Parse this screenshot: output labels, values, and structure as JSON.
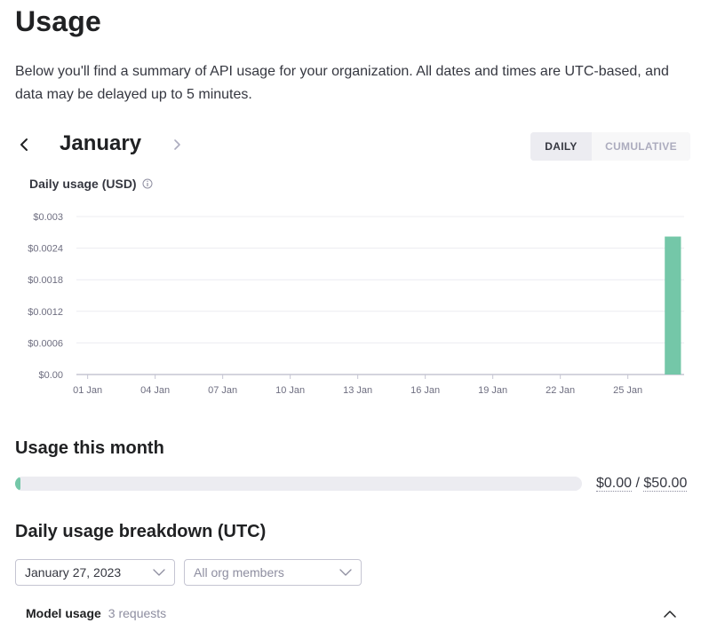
{
  "page": {
    "title": "Usage",
    "description": "Below you'll find a summary of API usage for your organization. All dates and times are UTC-based, and data may be delayed up to 5 minutes."
  },
  "month_nav": {
    "month": "January",
    "prev_icon": "chevron-left-icon",
    "next_icon": "chevron-right-icon"
  },
  "view_toggle": {
    "options": [
      "DAILY",
      "CUMULATIVE"
    ],
    "selected": "DAILY"
  },
  "chart_label": "Daily usage (USD)",
  "info_icon": "info-icon",
  "chart_data": {
    "type": "bar",
    "title": "Daily usage (USD)",
    "x_tick_labels": [
      "01 Jan",
      "04 Jan",
      "07 Jan",
      "10 Jan",
      "13 Jan",
      "16 Jan",
      "19 Jan",
      "22 Jan",
      "25 Jan"
    ],
    "y_tick_labels": [
      "$0.00",
      "$0.0006",
      "$0.0012",
      "$0.0018",
      "$0.0024",
      "$0.003"
    ],
    "ylim": [
      0,
      0.003
    ],
    "grid": true,
    "bar_color": "#74c7a8",
    "categories": [
      "01 Jan",
      "02 Jan",
      "03 Jan",
      "04 Jan",
      "05 Jan",
      "06 Jan",
      "07 Jan",
      "08 Jan",
      "09 Jan",
      "10 Jan",
      "11 Jan",
      "12 Jan",
      "13 Jan",
      "14 Jan",
      "15 Jan",
      "16 Jan",
      "17 Jan",
      "18 Jan",
      "19 Jan",
      "20 Jan",
      "21 Jan",
      "22 Jan",
      "23 Jan",
      "24 Jan",
      "25 Jan",
      "26 Jan",
      "27 Jan"
    ],
    "values": [
      0,
      0,
      0,
      0,
      0,
      0,
      0,
      0,
      0,
      0,
      0,
      0,
      0,
      0,
      0,
      0,
      0,
      0,
      0,
      0,
      0,
      0,
      0,
      0,
      0,
      0,
      0.00262
    ]
  },
  "usage_this_month": {
    "title": "Usage this month",
    "used": "$0.00",
    "separator": "/",
    "limit": "$50.00",
    "progress_fraction": 0.0,
    "fill_color": "#74c7a8"
  },
  "breakdown": {
    "title": "Daily usage breakdown (UTC)",
    "date_select_value": "January 27, 2023",
    "member_select_placeholder": "All org members",
    "model_usage_label": "Model usage",
    "model_usage_count": "3 requests"
  }
}
